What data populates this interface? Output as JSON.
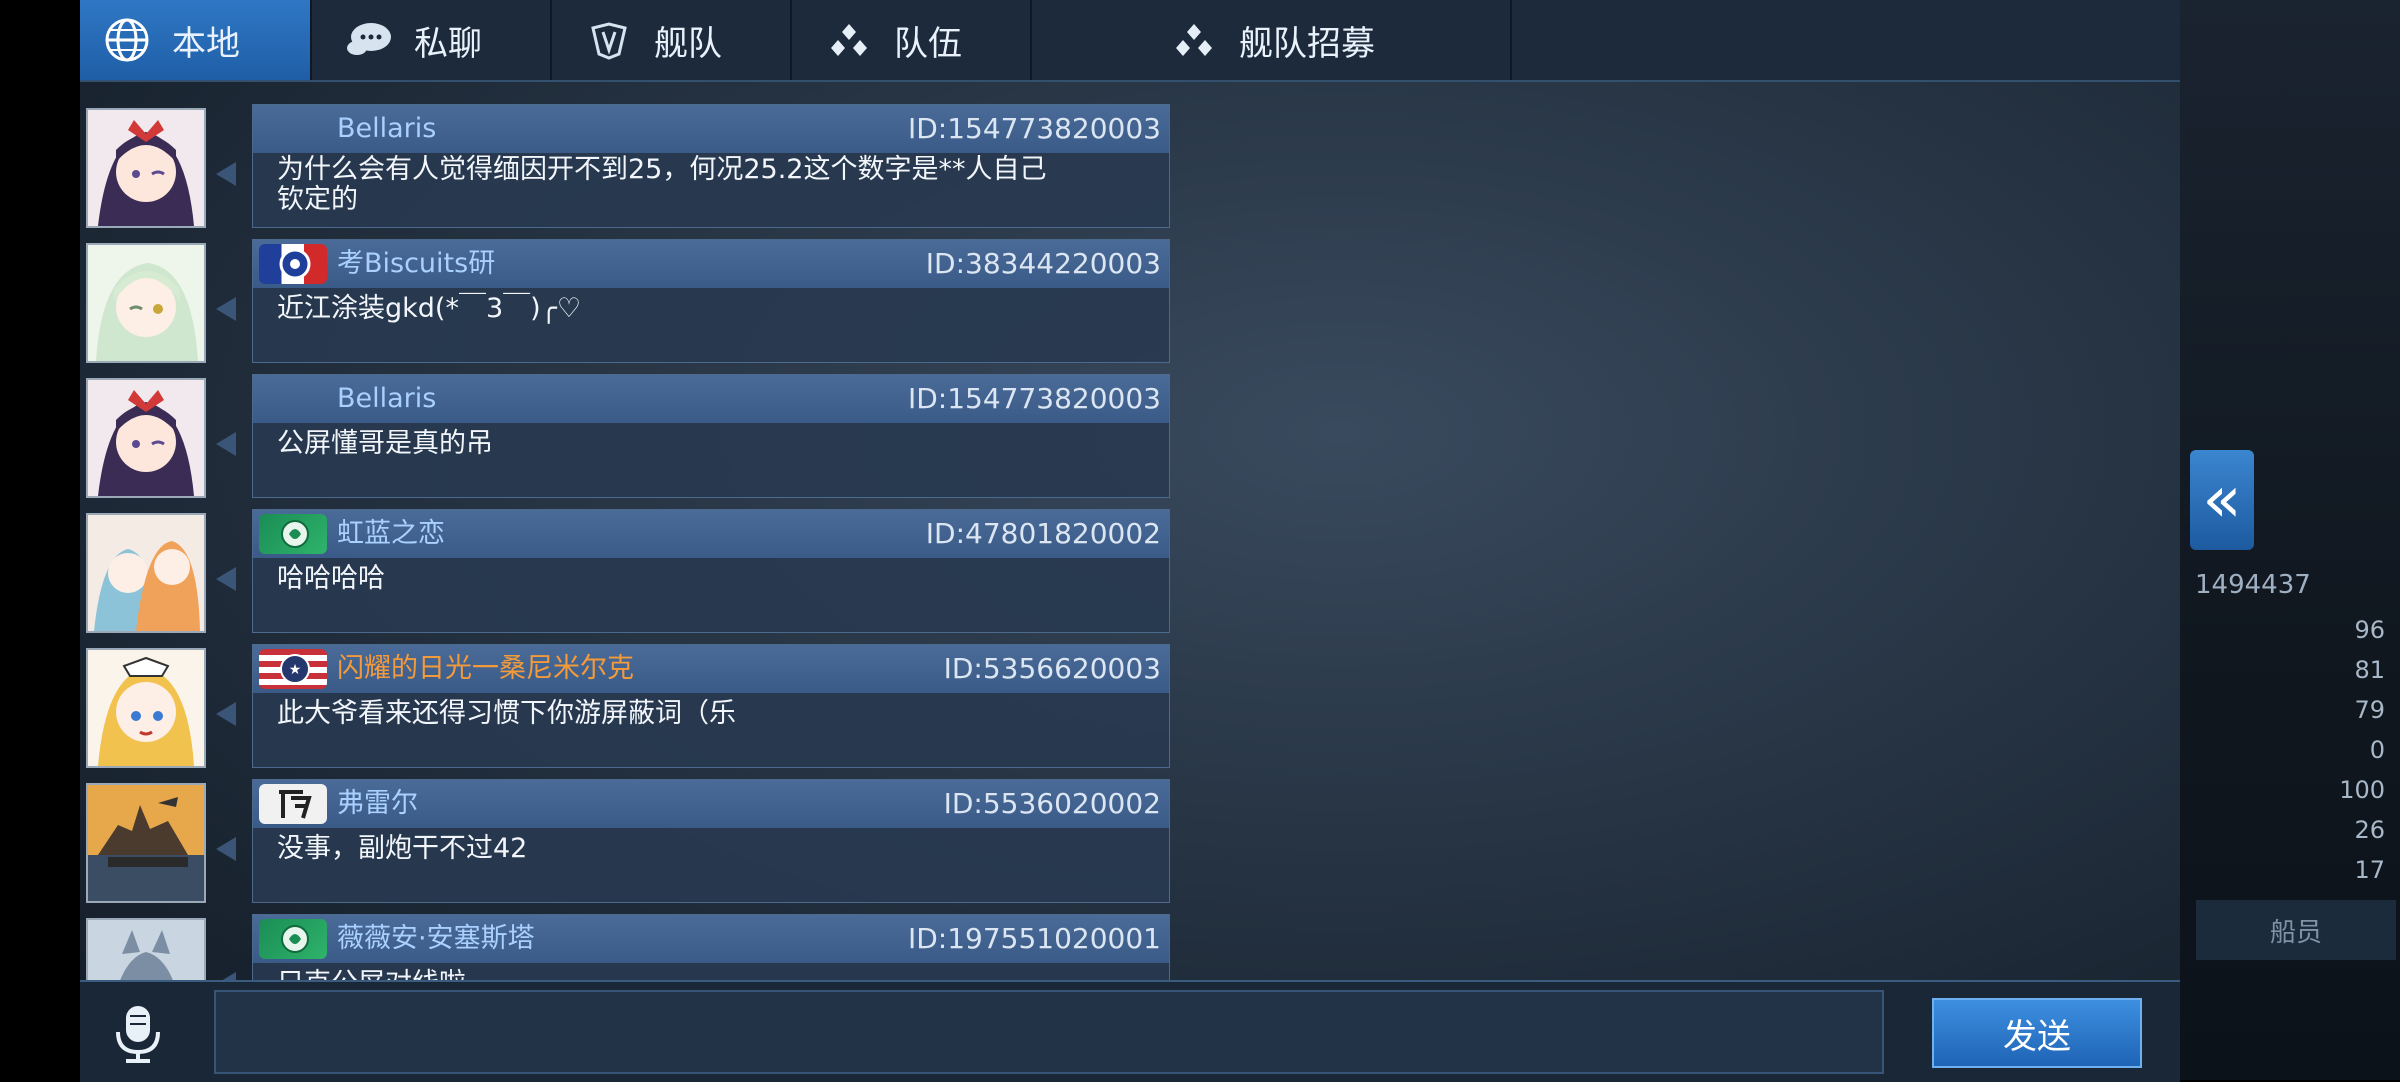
{
  "tabs": [
    {
      "label": "本地",
      "icon": "globe-icon",
      "active": true
    },
    {
      "label": "私聊",
      "icon": "chat-bubble-icon",
      "active": false
    },
    {
      "label": "舰队",
      "icon": "fleet-icon",
      "active": false
    },
    {
      "label": "队伍",
      "icon": "team-icon",
      "active": false
    },
    {
      "label": "舰队招募",
      "icon": "recruit-icon",
      "active": false
    }
  ],
  "messages": [
    {
      "name": "Bellaris",
      "id": "ID:154773820003",
      "text": "为什么会有人觉得缅因开不到25，何况25.2这个数字是**人自己\n钦定的",
      "flag": "",
      "avatar": "anime-girl-purple-hair-avatar"
    },
    {
      "name": "考Biscuits研",
      "id": "ID:38344220003",
      "text": "近江涂装gkd(*￣3￣)╭♡",
      "flag": "france-flag",
      "avatar": "anime-girl-green-hair-avatar"
    },
    {
      "name": "Bellaris",
      "id": "ID:154773820003",
      "text": "公屏懂哥是真的吊",
      "flag": "",
      "avatar": "anime-girl-purple-hair-avatar"
    },
    {
      "name": "虹蓝之恋",
      "id": "ID:47801820002",
      "text": "哈哈哈哈",
      "flag": "green-emblem-flag",
      "avatar": "anime-couple-avatar"
    },
    {
      "name": "闪耀的日光一桑尼米尔克",
      "id": "ID:5356620003",
      "text": "此大爷看来还得习惯下你游屏蔽词（乐",
      "flag": "usa-flag",
      "avatar": "anime-maid-avatar",
      "name_color": "orange"
    },
    {
      "name": "弗雷尔",
      "id": "ID:5536020002",
      "text": "没事，副炮干不过42",
      "flag": "calligraphy-flag",
      "avatar": "battleship-avatar"
    },
    {
      "name": "薇薇安·安塞斯塔",
      "id": "ID:197551020001",
      "text": "只克公屏对线啦",
      "flag": "green-emblem-flag",
      "avatar": "anime-cat-avatar"
    }
  ],
  "input": {
    "placeholder": "",
    "value": ""
  },
  "send_label": "发送",
  "side": {
    "id_text": "1494437",
    "crew_label": "船员",
    "stats": [
      "96",
      "81",
      "79",
      "0",
      "100",
      "26",
      "17"
    ]
  },
  "colors": {
    "active_tab": "#2f77c4",
    "name_blue": "#a9d0ff",
    "name_orange": "#f39a3a"
  }
}
